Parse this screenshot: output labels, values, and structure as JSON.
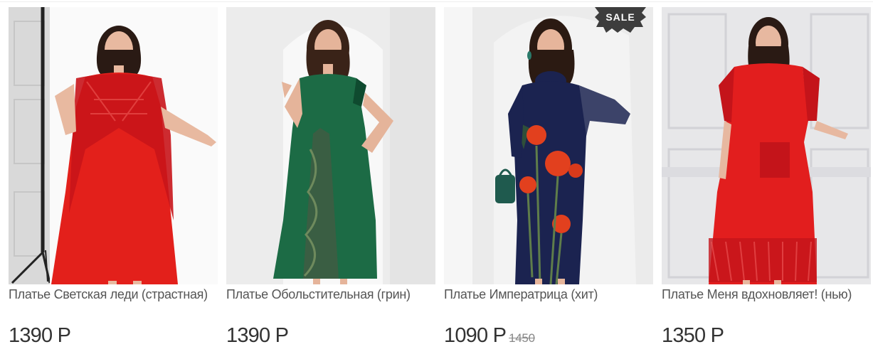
{
  "products": [
    {
      "name": "Платье Светская леди (страстная)",
      "price": "1390 Р",
      "old_price": "",
      "sale_badge": "",
      "dress_color": "#e3201b",
      "accent_color": "#c8141a"
    },
    {
      "name": "Платье Обольстительная (грин)",
      "price": "1390 Р",
      "old_price": "",
      "sale_badge": "",
      "dress_color": "#1c6b45",
      "accent_color": "#0f4a2f"
    },
    {
      "name": "Платье Императрица (хит)",
      "price": "1090 Р",
      "old_price": "1450",
      "sale_badge": "SALE",
      "dress_color": "#1b2350",
      "accent_color": "#e2401e"
    },
    {
      "name": "Платье Меня вдохновляет! (нью)",
      "price": "1350 Р",
      "old_price": "",
      "sale_badge": "",
      "dress_color": "#e21e1e",
      "accent_color": "#c4141a"
    }
  ]
}
